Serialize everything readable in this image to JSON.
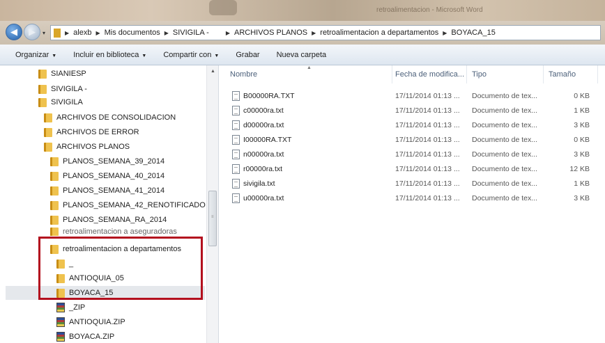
{
  "window": {
    "title": "retroalimentacion - Microsoft Word"
  },
  "address": {
    "recent_arrow": "▾",
    "crumbs": [
      "alexb",
      "Mis documentos",
      "SIVIGILA -",
      "ARCHIVOS PLANOS",
      "retroalimentacion a departamentos",
      "BOYACA_15"
    ]
  },
  "toolbar": {
    "organize": "Organizar",
    "library": "Incluir en biblioteca",
    "share": "Compartir con",
    "burn": "Grabar",
    "new_folder": "Nueva carpeta"
  },
  "tree": {
    "items": [
      "SIANIESP",
      "SIVIGILA -",
      "SIVIGILA",
      "ARCHIVOS DE CONSOLIDACION",
      "ARCHIVOS DE ERROR",
      "ARCHIVOS PLANOS",
      "PLANOS_SEMANA_39_2014",
      "PLANOS_SEMANA_40_2014",
      "PLANOS_SEMANA_41_2014",
      "PLANOS_SEMANA_42_RENOTIFICADO",
      "PLANOS_SEMANA_RA_2014",
      "retroalimentacion a aseguradoras",
      "retroalimentacion a departamentos",
      "_",
      "ANTIOQUIA_05",
      "BOYACA_15",
      "_ZIP",
      "ANTIOQUIA.ZIP",
      "BOYACA.ZIP"
    ]
  },
  "columns": {
    "name": "Nombre",
    "date": "Fecha de modifica...",
    "type": "Tipo",
    "size": "Tamaño"
  },
  "files": [
    {
      "name": "B00000RA.TXT",
      "date": "17/11/2014 01:13 ...",
      "type": "Documento de tex...",
      "size": "0 KB"
    },
    {
      "name": "c00000ra.txt",
      "date": "17/11/2014 01:13 ...",
      "type": "Documento de tex...",
      "size": "1 KB"
    },
    {
      "name": "d00000ra.txt",
      "date": "17/11/2014 01:13 ...",
      "type": "Documento de tex...",
      "size": "3 KB"
    },
    {
      "name": "I00000RA.TXT",
      "date": "17/11/2014 01:13 ...",
      "type": "Documento de tex...",
      "size": "0 KB"
    },
    {
      "name": "n00000ra.txt",
      "date": "17/11/2014 01:13 ...",
      "type": "Documento de tex...",
      "size": "3 KB"
    },
    {
      "name": "r00000ra.txt",
      "date": "17/11/2014 01:13 ...",
      "type": "Documento de tex...",
      "size": "12 KB"
    },
    {
      "name": "sivigila.txt",
      "date": "17/11/2014 01:13 ...",
      "type": "Documento de tex...",
      "size": "1 KB"
    },
    {
      "name": "u00000ra.txt",
      "date": "17/11/2014 01:13 ...",
      "type": "Documento de tex...",
      "size": "3 KB"
    }
  ],
  "colors": {
    "highlight": "#b3101e",
    "selection": "#e5e8ec"
  }
}
